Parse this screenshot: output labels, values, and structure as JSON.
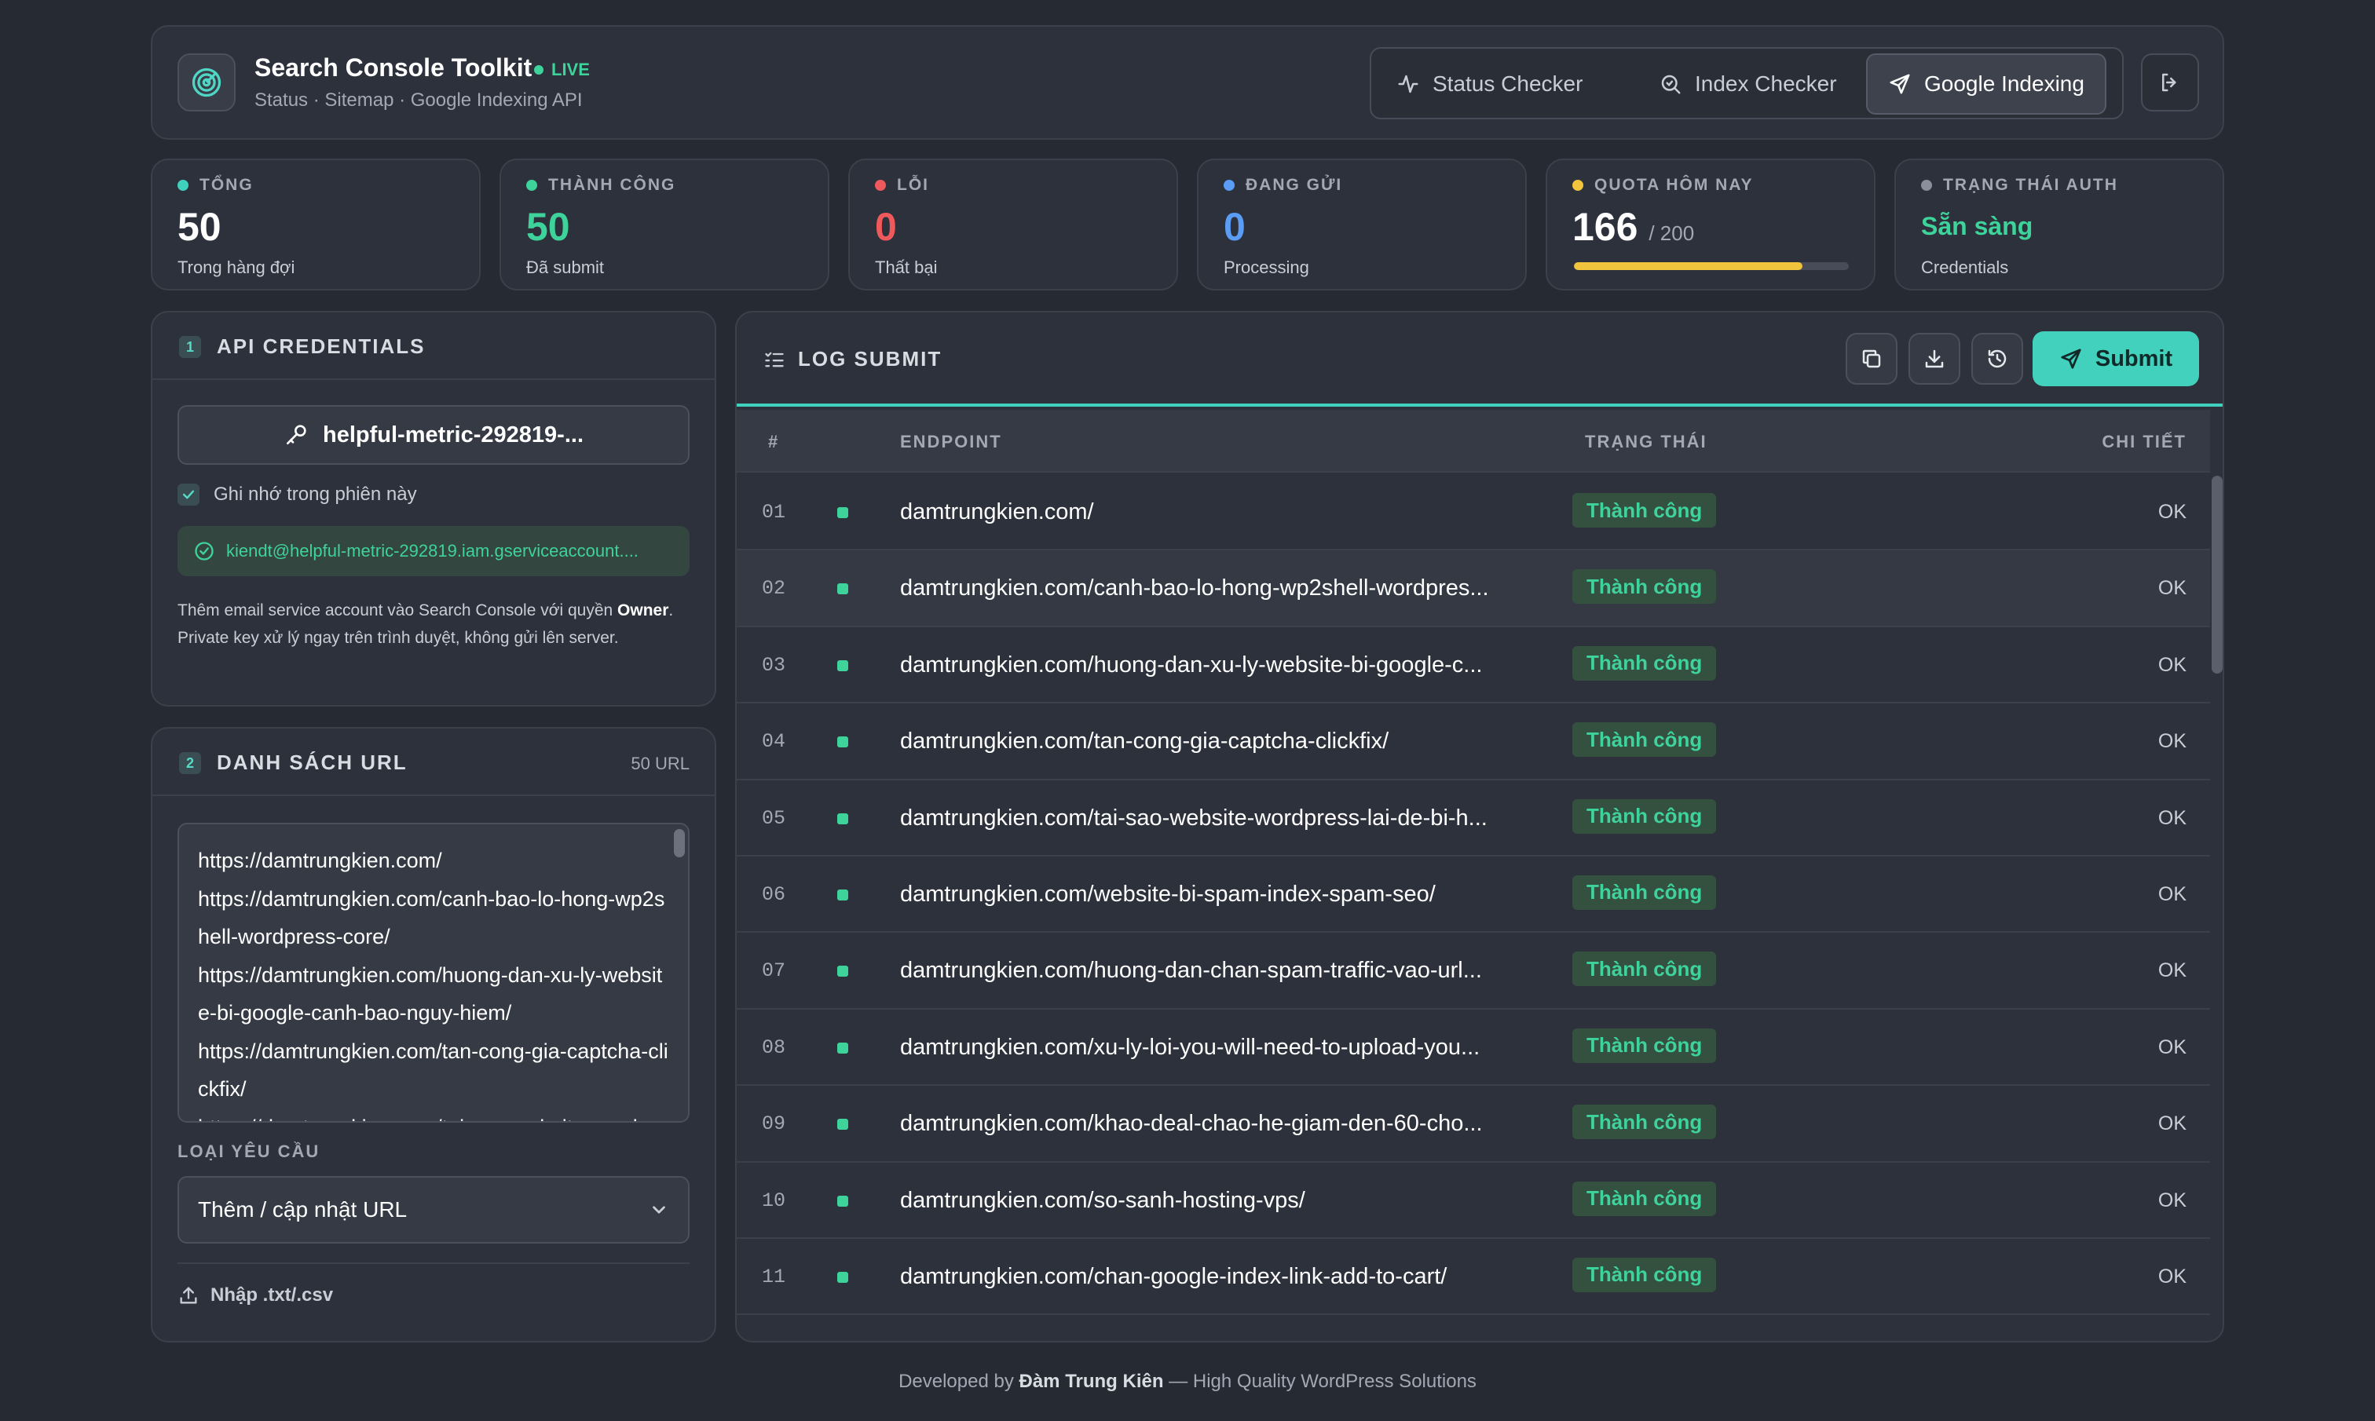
{
  "header": {
    "title": "Search Console Toolkit",
    "live": "LIVE",
    "subtitle": "Status · Sitemap · Google Indexing API",
    "tabs": [
      {
        "label": "Status Checker",
        "icon": "activity-icon"
      },
      {
        "label": "Index Checker",
        "icon": "search-icon"
      },
      {
        "label": "Google Indexing",
        "icon": "send-icon",
        "active": true
      }
    ],
    "logout_icon": "logout-icon"
  },
  "stats": [
    {
      "label": "TỔNG",
      "value": "50",
      "note": "Trong hàng đợi",
      "color": "#3fd1bd"
    },
    {
      "label": "THÀNH CÔNG",
      "value": "50",
      "note": "Đã submit",
      "color": "#3ed39a"
    },
    {
      "label": "LỖI",
      "value": "0",
      "note": "Thất bại",
      "color": "#f0595c"
    },
    {
      "label": "ĐANG GỬI",
      "value": "0",
      "note": "Processing",
      "color": "#5b9cf5"
    },
    {
      "label": "QUOTA HÔM NAY",
      "value": "166",
      "max": "/ 200",
      "fraction": 0.83,
      "color": "#f0c43c"
    },
    {
      "label": "TRẠNG THÁI AUTH",
      "value": "Sẵn sàng",
      "note": "Credentials",
      "color": "#8a909b"
    }
  ],
  "credentials": {
    "step": "1",
    "title": "API CREDENTIALS",
    "key_button": "helpful-metric-292819-...",
    "remember": "Ghi nhớ trong phiên này",
    "email": "kiendt@helpful-metric-292819.iam.gserviceaccount....",
    "help_1": "Thêm email service account vào Search Console với quyền ",
    "help_bold": "Owner",
    "help_2": ". Private key xử lý ngay trên trình duyệt, không gửi lên server."
  },
  "url_list": {
    "step": "2",
    "title": "DANH SÁCH URL",
    "count": "50 URL",
    "lines": [
      "https://damtrungkien.com/",
      "https://damtrungkien.com/canh-bao-lo-hong-wp2shell-wordpress-core/",
      "https://damtrungkien.com/huong-dan-xu-ly-website-bi-google-canh-bao-nguy-hiem/",
      "https://damtrungkien.com/tan-cong-gia-captcha-clickfix/",
      "https://damtrungkien.com/tai-sao-website-wordpress-lai-de-bi-hack/"
    ],
    "request_type_label": "LOẠI YÊU CẦU",
    "request_type": "Thêm / cập nhật URL",
    "import": "Nhập .txt/.csv"
  },
  "log": {
    "title": "LOG SUBMIT",
    "submit": "Submit",
    "columns": {
      "num": "#",
      "endpoint": "ENDPOINT",
      "status": "TRẠNG THÁI",
      "detail": "CHI TIẾT"
    },
    "rows": [
      {
        "num": "01",
        "endpoint": "damtrungkien.com/",
        "status": "Thành công",
        "detail": "OK"
      },
      {
        "num": "02",
        "endpoint": "damtrungkien.com/canh-bao-lo-hong-wp2shell-wordpres...",
        "status": "Thành công",
        "detail": "OK"
      },
      {
        "num": "03",
        "endpoint": "damtrungkien.com/huong-dan-xu-ly-website-bi-google-c...",
        "status": "Thành công",
        "detail": "OK"
      },
      {
        "num": "04",
        "endpoint": "damtrungkien.com/tan-cong-gia-captcha-clickfix/",
        "status": "Thành công",
        "detail": "OK"
      },
      {
        "num": "05",
        "endpoint": "damtrungkien.com/tai-sao-website-wordpress-lai-de-bi-h...",
        "status": "Thành công",
        "detail": "OK"
      },
      {
        "num": "06",
        "endpoint": "damtrungkien.com/website-bi-spam-index-spam-seo/",
        "status": "Thành công",
        "detail": "OK"
      },
      {
        "num": "07",
        "endpoint": "damtrungkien.com/huong-dan-chan-spam-traffic-vao-url...",
        "status": "Thành công",
        "detail": "OK"
      },
      {
        "num": "08",
        "endpoint": "damtrungkien.com/xu-ly-loi-you-will-need-to-upload-you...",
        "status": "Thành công",
        "detail": "OK"
      },
      {
        "num": "09",
        "endpoint": "damtrungkien.com/khao-deal-chao-he-giam-den-60-cho...",
        "status": "Thành công",
        "detail": "OK"
      },
      {
        "num": "10",
        "endpoint": "damtrungkien.com/so-sanh-hosting-vps/",
        "status": "Thành công",
        "detail": "OK"
      },
      {
        "num": "11",
        "endpoint": "damtrungkien.com/chan-google-index-link-add-to-cart/",
        "status": "Thành công",
        "detail": "OK"
      }
    ]
  },
  "footer": {
    "prefix": "Developed by ",
    "author": "Đàm Trung Kiên",
    "suffix": " — High Quality WordPress Solutions"
  }
}
